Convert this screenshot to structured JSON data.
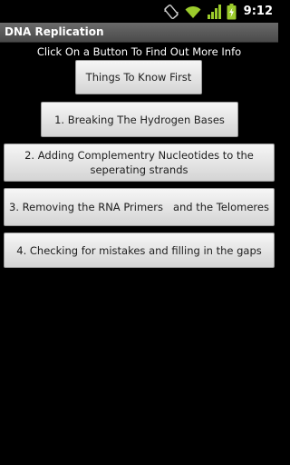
{
  "status_bar": {
    "time": "9:12",
    "icons": [
      "screen-rotation-icon",
      "wifi-icon",
      "cell-signal-icon",
      "battery-charging-icon"
    ]
  },
  "app": {
    "title": "DNA Replication"
  },
  "main": {
    "instruction": "Click On a Button To Find Out More Info",
    "buttons": [
      {
        "label": "Things To Know First"
      },
      {
        "label": "1. Breaking The Hydrogen Bases"
      },
      {
        "label": "2. Adding Complementry Nucleotides to the seperating strands"
      },
      {
        "label": "3. Removing the RNA Primers   and the Telomeres"
      },
      {
        "label": "4. Checking for mistakes and filling in the gaps"
      }
    ]
  },
  "colors": {
    "background": "#000000",
    "title_bar": "#5a5a5a",
    "button_face": "#e6e6e6",
    "button_text": "#1e1e1e",
    "status_accent": "#9ccc2c"
  }
}
